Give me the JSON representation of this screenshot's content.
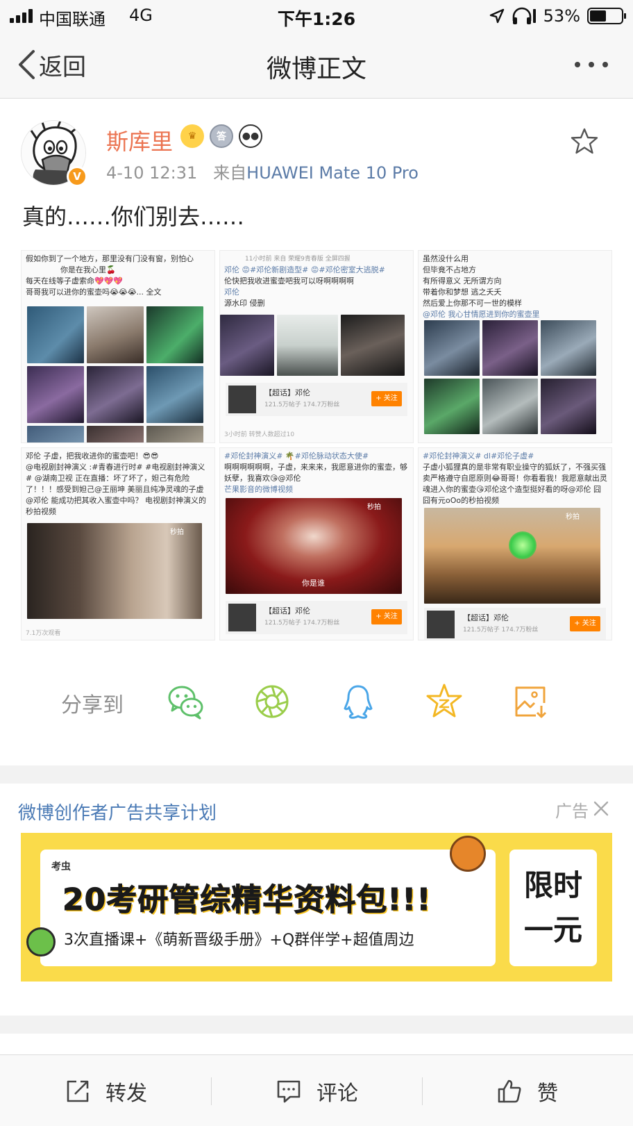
{
  "status_bar": {
    "carrier": "中国联通",
    "network": "4G",
    "time": "下午1:26",
    "battery": "53%",
    "battery_level": 0.53
  },
  "nav": {
    "back_label": "返回",
    "title": "微博正文"
  },
  "post": {
    "user_name": "斯库里",
    "verified_badge": "V",
    "badge_icons": [
      "crown-icon",
      "medal-icon",
      "panda-icon"
    ],
    "date": "4-10 12:31",
    "source_prefix": "来自",
    "source": "HUAWEI Mate 10 Pro",
    "text": "真的……你们别去……",
    "images": [
      {
        "caption_lines": [
          "假如你到了一个地方，那里没有门没有窗，别怕心",
          "你是在我心里🍒",
          "每天在线等子虚索命💖💖💖",
          "哥哥我可以进你的蜜壶吗😭😭😭... 全文"
        ]
      },
      {
        "caption_top": "11小时前  来自 荣耀9青春版 全屏四握",
        "caption_lines": [
          "邓伦 😡#邓伦新剧造型# 😡#邓伦密室大逃脱#",
          "伦快把我收进蜜壶吧我可以呀啊啊啊啊",
          "邓伦",
          "源水印 侵删"
        ],
        "card_title": "【超话】邓伦",
        "card_stats": "121.5万帖子 174.7万粉丝",
        "card_button": "+ 关注",
        "footer": "3小时前  转赞人数超过10"
      },
      {
        "caption_lines": [
          "虽然没什么用",
          "但毕竟不占地方",
          "有所得意义 无所谓方向",
          "带着你和梦想 逃之夭夭",
          "然后爱上你那不可一世的模样",
          "@邓伦 我心甘情愿进到你的蜜壶里"
        ]
      },
      {
        "caption_lines": [
          "邓伦 子虚，把我收进你的蜜壶吧！😎😎",
          "@电视剧封神演义 :#青春进行时# #电视剧封神演义# @湖南卫视 正在直播：坏了坏了，妲己有危险了！！！感受到妲己@王丽坤 美丽且纯净灵魂的子虚@邓伦 能成功把其收入蜜壶中吗？ 电视剧封神演义的秒拍视频"
        ],
        "video_tag": "秒拍",
        "footer": "7.1万次观看"
      },
      {
        "caption_lines": [
          "#邓伦封神演义# 🌴#邓伦脉动状态大使#",
          "啊啊啊啊啊啊，子虚，来来来，我愿意进你的蜜壶，够妖孽，我喜欢😘@邓伦",
          "芒果影音的微博视频"
        ],
        "video_tag": "秒拍",
        "subtitle": "你是谁",
        "card_title": "【超话】邓伦",
        "card_stats": "121.5万帖子 174.7万粉丝",
        "card_button": "+ 关注"
      },
      {
        "caption_lines": [
          "#邓伦封神演义# dl#邓伦子虚#",
          "子虚小狐狸真的是非常有职业操守的狐妖了，不强买强卖严格遵守自愿原则😂哥哥！你看看我！我愿意献出灵魂进入你的蜜壶😘邓伦这个造型挺好看的呀@邓伦 囧囧有元oOo的秒拍视频"
        ],
        "video_tag": "秒拍",
        "card_title": "【超话】邓伦",
        "card_stats": "121.5万帖子 174.7万粉丝",
        "card_button": "+ 关注"
      }
    ]
  },
  "share": {
    "label": "分享到",
    "targets": [
      "wechat-icon",
      "moments-icon",
      "qq-icon",
      "qzone-icon",
      "save-image-icon"
    ]
  },
  "ad": {
    "title": "微博创作者广告共享计划",
    "label": "广告",
    "brand": "考虫",
    "headline": "20考研管综精华资料包!!!",
    "subline": "3次直播课+《萌新晋级手册》+Q群伴学+超值周边",
    "side_line1": "限时",
    "side_line2": "一元"
  },
  "bottom_bar": {
    "repost": "转发",
    "comment": "评论",
    "like": "赞"
  },
  "colors": {
    "username": "#eb7350",
    "link": "#5b7ba7",
    "ad_title": "#4a7ab5",
    "ad_banner": "#fadb4a"
  }
}
